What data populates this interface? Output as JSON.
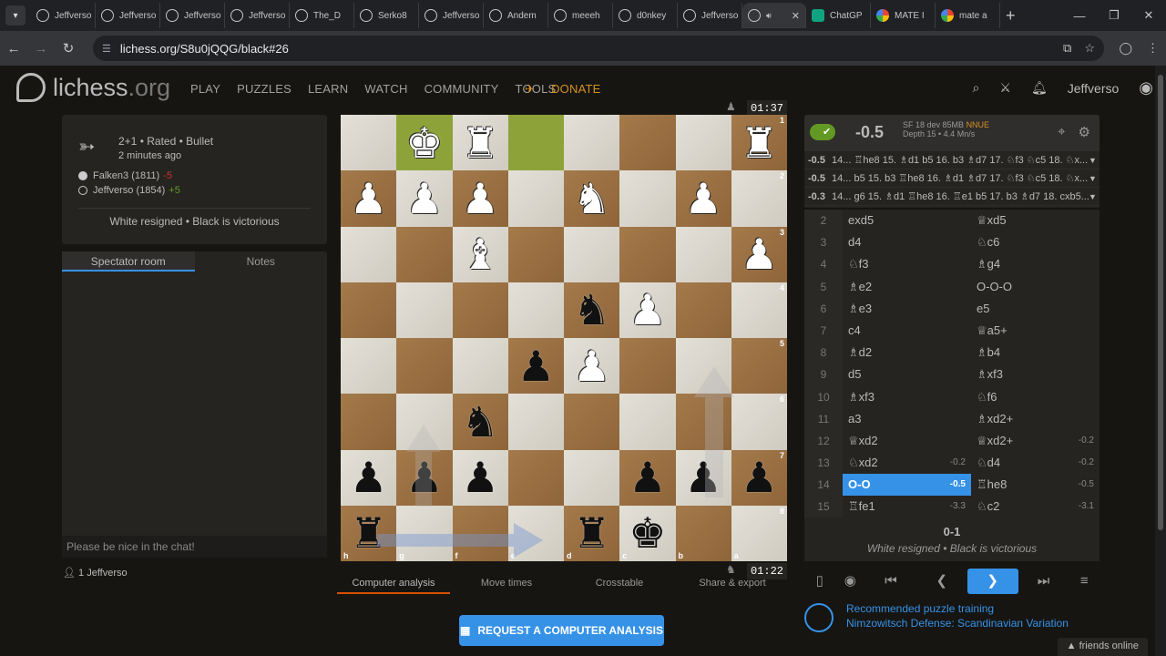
{
  "browser": {
    "tabs": [
      {
        "title": "Jeffverso",
        "kind": "li"
      },
      {
        "title": "Jeffverso",
        "kind": "li"
      },
      {
        "title": "Jeffverso",
        "kind": "li"
      },
      {
        "title": "Jeffverso",
        "kind": "li"
      },
      {
        "title": "The_D",
        "kind": "li"
      },
      {
        "title": "Serko8",
        "kind": "li"
      },
      {
        "title": "Jeffverso",
        "kind": "li"
      },
      {
        "title": "Andem",
        "kind": "li"
      },
      {
        "title": "meeeh",
        "kind": "li"
      },
      {
        "title": "d0nkey",
        "kind": "li"
      },
      {
        "title": "Jeffverso",
        "kind": "li"
      },
      {
        "title": "",
        "kind": "li-active"
      },
      {
        "title": "ChatGP",
        "kind": "ai"
      },
      {
        "title": "MATE I",
        "kind": "g"
      },
      {
        "title": "mate a",
        "kind": "g"
      }
    ],
    "url": "lichess.org/S8u0jQQG/black#26"
  },
  "site": {
    "logo_main": "lichess",
    "logo_tld": ".org",
    "nav": [
      "PLAY",
      "PUZZLES",
      "LEARN",
      "WATCH",
      "COMMUNITY",
      "TOOLS"
    ],
    "donate": "DONATE",
    "username": "Jeffverso"
  },
  "game": {
    "title": "2+1 • Rated • Bullet",
    "date": "2 minutes ago",
    "white_player": "Falken3 (1811)",
    "white_diff": "-5",
    "black_player": "Jeffverso (1854)",
    "black_diff": "+5",
    "result_text": "White resigned • Black is victorious"
  },
  "chat": {
    "tabs": [
      "Spectator room",
      "Notes"
    ],
    "placeholder": "Please be nice in the chat!",
    "spectators": "1 Jeffverso"
  },
  "clocks": {
    "top": "01:37",
    "bottom": "01:22"
  },
  "board": {
    "ranks": [
      "1",
      "2",
      "3",
      "4",
      "5",
      "6",
      "7",
      "8"
    ],
    "files": [
      "h",
      "g",
      "f",
      "e",
      "d",
      "c",
      "b",
      "a"
    ],
    "rows": [
      [
        "",
        "K",
        "R",
        "",
        "",
        "",
        "",
        "R"
      ],
      [
        "P",
        "P",
        "P",
        "",
        "N",
        "",
        "P",
        ""
      ],
      [
        "",
        "",
        "B",
        "",
        "",
        "",
        "",
        "P"
      ],
      [
        "",
        "",
        "",
        "",
        "n",
        "P",
        "",
        ""
      ],
      [
        "",
        "",
        "",
        "p",
        "P",
        "",
        "",
        ""
      ],
      [
        "",
        "",
        "n",
        "",
        "",
        "",
        "",
        ""
      ],
      [
        "p",
        "p",
        "p",
        "",
        "",
        "p",
        "p",
        "p"
      ],
      [
        "r",
        "",
        "",
        "",
        "r",
        "k",
        "",
        ""
      ]
    ],
    "highlight": [
      [
        0,
        1
      ],
      [
        0,
        3
      ]
    ]
  },
  "game_tabs": [
    "Computer analysis",
    "Move times",
    "Crosstable",
    "Share & export"
  ],
  "request_button": "REQUEST A COMPUTER ANALYSIS",
  "ceval": {
    "score": "-0.5",
    "engine": "SF 18 dev 85MB",
    "nnue": "NNUE",
    "depth": "Depth 15 • 4.4 Mn/s",
    "pvs": [
      {
        "eval": "-0.5",
        "line": "14... ♖he8 15. ♗d1 b5 16. b3 ♗d7 17. ♘f3 ♘c5 18. ♘x..."
      },
      {
        "eval": "-0.5",
        "line": "14... b5 15. b3 ♖he8 16. ♗d1 ♗d7 17. ♘f3 ♘c5 18. ♘x..."
      },
      {
        "eval": "-0.3",
        "line": "14... g6 15. ♗d1 ♖he8 16. ♖e1 b5 17. b3 ♗d7 18. cxb5..."
      }
    ]
  },
  "moves": [
    {
      "n": "2",
      "w": "exd5",
      "we": "",
      "b": "♕xd5",
      "be": ""
    },
    {
      "n": "3",
      "w": "d4",
      "we": "",
      "b": "♘c6",
      "be": ""
    },
    {
      "n": "4",
      "w": "♘f3",
      "we": "",
      "b": "♗g4",
      "be": ""
    },
    {
      "n": "5",
      "w": "♗e2",
      "we": "",
      "b": "O-O-O",
      "be": ""
    },
    {
      "n": "6",
      "w": "♗e3",
      "we": "",
      "b": "e5",
      "be": ""
    },
    {
      "n": "7",
      "w": "c4",
      "we": "",
      "b": "♕a5+",
      "be": ""
    },
    {
      "n": "8",
      "w": "♗d2",
      "we": "",
      "b": "♗b4",
      "be": ""
    },
    {
      "n": "9",
      "w": "d5",
      "we": "",
      "b": "♗xf3",
      "be": ""
    },
    {
      "n": "10",
      "w": "♗xf3",
      "we": "",
      "b": "♘f6",
      "be": ""
    },
    {
      "n": "11",
      "w": "a3",
      "we": "",
      "b": "♗xd2+",
      "be": ""
    },
    {
      "n": "12",
      "w": "♕xd2",
      "we": "",
      "b": "♕xd2+",
      "be": "-0.2"
    },
    {
      "n": "13",
      "w": "♘xd2",
      "we": "-0.2",
      "b": "♘d4",
      "be": "-0.2"
    },
    {
      "n": "14",
      "w": "O-O",
      "we": "-0.5",
      "b": "♖he8",
      "be": "-0.5",
      "cur": "w"
    },
    {
      "n": "15",
      "w": "♖fe1",
      "we": "-3.3",
      "b": "♘c2",
      "be": "-3.1"
    }
  ],
  "result": {
    "score": "0-1",
    "text": "White resigned • Black is victorious"
  },
  "puzzle": {
    "line1": "Recommended puzzle training",
    "line2": "Nimzowitsch Defense: Scandinavian Variation"
  },
  "friends": "friends online",
  "colors": {
    "accent": "#3692e7",
    "donate": "#d59120",
    "win": "#629924",
    "loss": "#cc3333"
  }
}
